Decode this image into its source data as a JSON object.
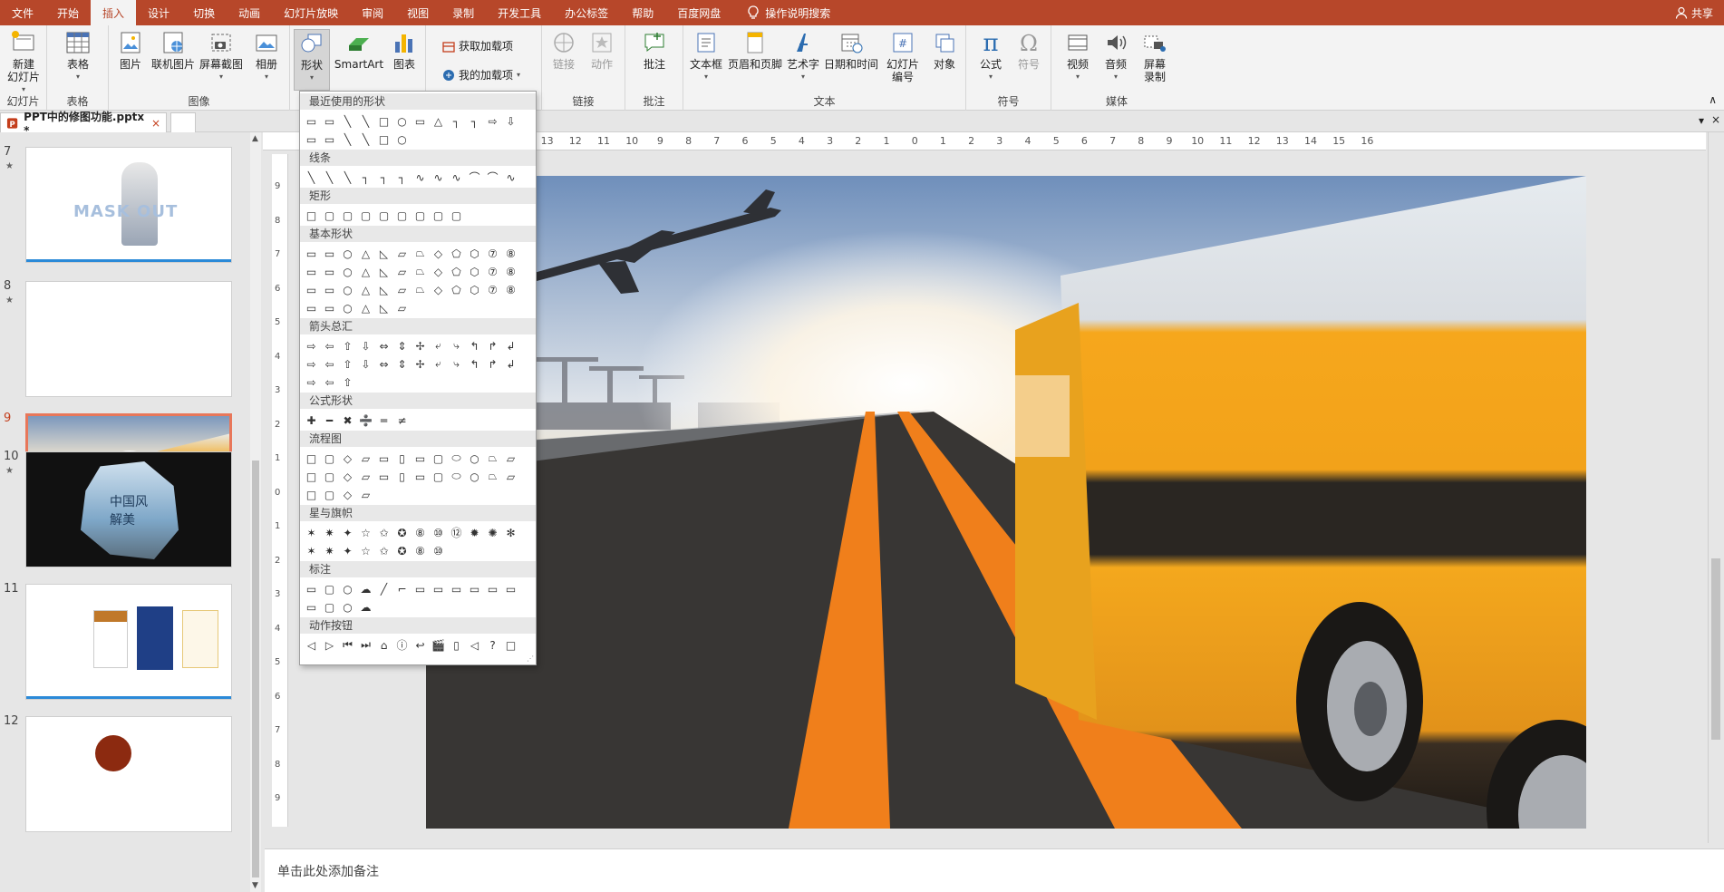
{
  "menubar": {
    "tabs": [
      "文件",
      "开始",
      "插入",
      "设计",
      "切换",
      "动画",
      "幻灯片放映",
      "审阅",
      "视图",
      "录制",
      "开发工具",
      "办公标签",
      "帮助",
      "百度网盘"
    ],
    "active_tab": "插入",
    "tell_me": "操作说明搜索",
    "share": "共享"
  },
  "ribbon": {
    "slides": {
      "new_slide": "新建\n幻灯片",
      "group": "幻灯片"
    },
    "tables": {
      "table": "表格",
      "group": "表格"
    },
    "images": {
      "picture": "图片",
      "online_picture": "联机图片",
      "screenshot": "屏幕截图",
      "album": "相册",
      "group": "图像"
    },
    "illustrations": {
      "shapes": "形状",
      "smartart": "SmartArt",
      "chart": "图表"
    },
    "addins": {
      "get_addins": "获取加载项",
      "my_addins": "我的加载项"
    },
    "links": {
      "link": "链接",
      "action": "动作",
      "group": "链接"
    },
    "comments": {
      "comment": "批注",
      "group": "批注"
    },
    "text": {
      "textbox": "文本框",
      "header_footer": "页眉和页脚",
      "wordart": "艺术字",
      "datetime": "日期和时间",
      "slide_number": "幻灯片\n编号",
      "object": "对象",
      "group": "文本"
    },
    "symbols": {
      "equation": "公式",
      "symbol": "符号",
      "group": "符号"
    },
    "media": {
      "video": "视频",
      "audio": "音频",
      "screen_record": "屏幕\n录制",
      "group": "媒体"
    }
  },
  "file_tab": {
    "name": "PPT中的修图功能.pptx *",
    "close": "×"
  },
  "thumbnails": [
    {
      "num": "7",
      "star": "★",
      "text": "MASK OUT"
    },
    {
      "num": "8",
      "star": "★",
      "text": ""
    },
    {
      "num": "9",
      "star": "",
      "text": ""
    },
    {
      "num": "10",
      "star": "★",
      "text": "中国风 解美"
    },
    {
      "num": "11",
      "star": "",
      "text": ""
    },
    {
      "num": "12",
      "star": "",
      "text": ""
    }
  ],
  "current_slide": "9",
  "shapes_menu": {
    "categories": [
      "最近使用的形状",
      "线条",
      "矩形",
      "基本形状",
      "箭头总汇",
      "公式形状",
      "流程图",
      "星与旗帜",
      "标注",
      "动作按钮"
    ]
  },
  "ruler": {
    "h_ticks": [
      "16",
      "15",
      "14",
      "13",
      "12",
      "11",
      "10",
      "9",
      "8",
      "7",
      "6",
      "5",
      "4",
      "3",
      "2",
      "1",
      "0",
      "1",
      "2",
      "3",
      "4",
      "5",
      "6",
      "7",
      "8",
      "9",
      "10",
      "11",
      "12",
      "13",
      "14",
      "15",
      "16"
    ],
    "v_ticks": [
      "9",
      "8",
      "7",
      "6",
      "5",
      "4",
      "3",
      "2",
      "1",
      "0",
      "1",
      "2",
      "3",
      "4",
      "5",
      "6",
      "7",
      "8",
      "9"
    ]
  },
  "notes_placeholder": "单击此处添加备注",
  "colors": {
    "accent": "#b7472a",
    "selected_thumb_border": "#e8775a",
    "road_stripe": "#f07f1b",
    "truck_yellow": "#f4a81d"
  }
}
